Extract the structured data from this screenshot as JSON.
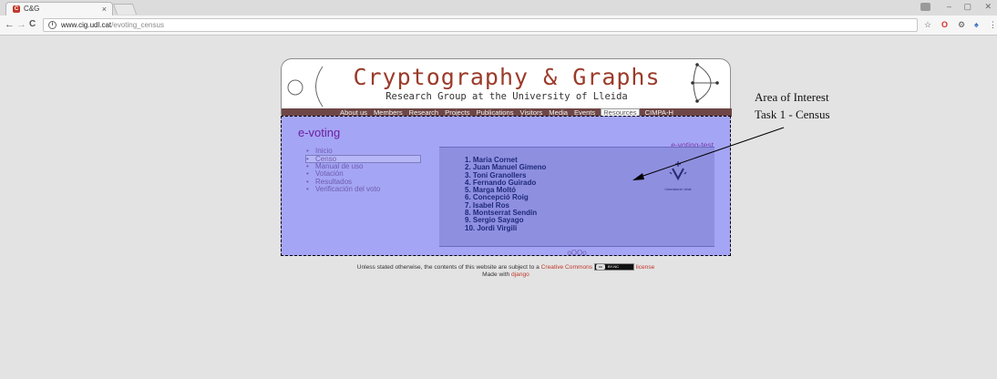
{
  "browser": {
    "tab": {
      "favicon": "C",
      "title": "C&G",
      "close": "×"
    },
    "window_controls": {
      "minimize": "–",
      "maximize": "▢",
      "close": "✕"
    },
    "nav": {
      "back": "←",
      "forward": "→",
      "reload": "C"
    },
    "address": {
      "info": "i",
      "host": "www.cig.udl.cat",
      "path": "/evoting_census"
    },
    "extensions": {
      "star": "☆",
      "opera": "O",
      "ext2": "⚙",
      "ext3": "♠",
      "menu": "⋮"
    }
  },
  "site": {
    "title": "Cryptography & Graphs",
    "subtitle": "Research Group at the University of Lleida",
    "menu": [
      "About us",
      "Members",
      "Research",
      "Projects",
      "Publications",
      "Visitors",
      "Media",
      "Events",
      "Resources",
      "CIMPA-H"
    ],
    "active_menu": "Resources"
  },
  "page": {
    "heading": "e-voting",
    "subpage_label": "e-voting-test",
    "sidebar": [
      "Inicio",
      "Censo",
      "Manual de uso",
      "Votación",
      "Resultados",
      "Verificación del voto"
    ],
    "selected_sidebar": "Censo",
    "census": [
      "1. Maria Cornet",
      "2. Juan Manuel Gimeno",
      "3. Toni Granollers",
      "4. Fernando Guirado",
      "5. Marga Moltó",
      "6. Concepció Roig",
      "7. Isabel Ros",
      "8. Montserrat Sendín",
      "9. Sergio Sayago",
      "10. Jordi Virgili"
    ],
    "census_footer": "oOOo",
    "university_caption": "Universitat de Lleida"
  },
  "footer": {
    "prefix": "Unless stated otherwise, the contents of this website are subject to a",
    "cc_link": "Creative Commons",
    "cc_badge_symbol": "cc",
    "cc_badge_text": "BY-NC",
    "license": "license",
    "made_with": "Made with",
    "django": "django"
  },
  "annotation": {
    "title": "Area of Interest",
    "task": "Task 1 - Census"
  },
  "colors": {
    "content_bg": "#a5a5f5",
    "census_bg": "#8f8fe0",
    "menu_bg": "#6e4646",
    "title_red": "#9b3b2a"
  }
}
